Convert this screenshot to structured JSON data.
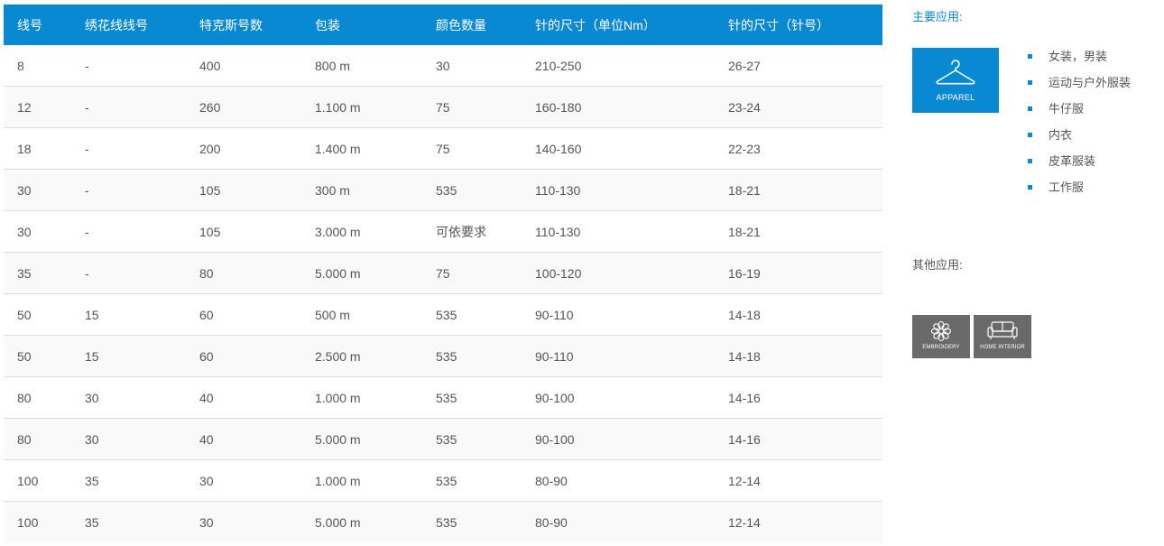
{
  "table": {
    "headers": [
      "线号",
      "绣花线线号",
      "特克斯号数",
      "包装",
      "颜色数量",
      "针的尺寸（单位Nm）",
      "针的尺寸（针号）"
    ],
    "rows": [
      [
        "8",
        "-",
        "400",
        "800 m",
        "30",
        "210-250",
        "26-27"
      ],
      [
        "12",
        "-",
        "260",
        "1.100 m",
        "75",
        "160-180",
        "23-24"
      ],
      [
        "18",
        "-",
        "200",
        "1.400 m",
        "75",
        "140-160",
        "22-23"
      ],
      [
        "30",
        "-",
        "105",
        "300 m",
        "535",
        "110-130",
        "18-21"
      ],
      [
        "30",
        "-",
        "105",
        "3.000 m",
        "可依要求",
        "110-130",
        "18-21"
      ],
      [
        "35",
        "-",
        "80",
        "5.000 m",
        "75",
        "100-120",
        "16-19"
      ],
      [
        "50",
        "15",
        "60",
        "500 m",
        "535",
        "90-110",
        "14-18"
      ],
      [
        "50",
        "15",
        "60",
        "2.500 m",
        "535",
        "90-110",
        "14-18"
      ],
      [
        "80",
        "30",
        "40",
        "1.000 m",
        "535",
        "90-100",
        "14-16"
      ],
      [
        "80",
        "30",
        "40",
        "5.000 m",
        "535",
        "90-100",
        "14-16"
      ],
      [
        "100",
        "35",
        "30",
        "1.000 m",
        "535",
        "80-90",
        "12-14"
      ],
      [
        "100",
        "35",
        "30",
        "5.000 m",
        "535",
        "80-90",
        "12-14"
      ]
    ]
  },
  "main_applications": {
    "heading": "主要应用:",
    "tile": {
      "label": "APPAREL",
      "icon": "hanger-icon"
    },
    "items": [
      "女装，男装",
      "运动与户外服装",
      "牛仔服",
      "内衣",
      "皮革服装",
      "工作服"
    ]
  },
  "other_applications": {
    "heading": "其他应用:",
    "tiles": [
      {
        "label": "EMBROIDERY",
        "icon": "flower-icon"
      },
      {
        "label": "HOME INTERIOR",
        "icon": "sofa-icon"
      }
    ]
  },
  "colors": {
    "accent": "#0a89d3",
    "tile_gray": "#6a6a6a",
    "row_alt": "#f9f9f9",
    "border": "#dcdcdc"
  }
}
